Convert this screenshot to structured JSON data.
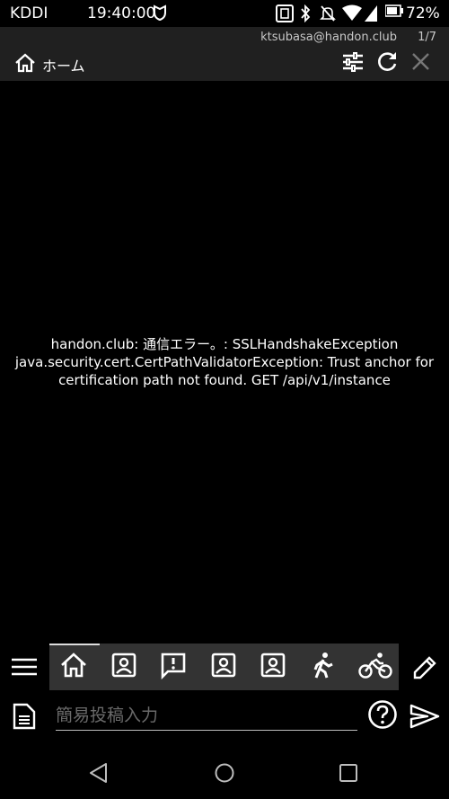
{
  "status_bar": {
    "carrier": "KDDI",
    "time": "19:40:00",
    "battery_percent": "72%",
    "icons": [
      "shield-icon",
      "nfc-icon",
      "bluetooth-icon",
      "mute-icon",
      "wifi-icon",
      "battery-icon"
    ]
  },
  "header": {
    "account": "ktsubasa@handon.club",
    "page_indicator": "1/7",
    "column_title": "ホーム"
  },
  "main": {
    "error_lines": [
      "handon.club: 通信エラー。: SSLHandshakeException",
      "java.security.cert.CertPathValidatorException: Trust anchor for",
      "certification path not found. GET /api/v1/instance"
    ]
  },
  "tabs": [
    {
      "icon": "home-icon",
      "selected": true
    },
    {
      "icon": "contact-icon"
    },
    {
      "icon": "notification-icon"
    },
    {
      "icon": "contact-icon"
    },
    {
      "icon": "contact-icon"
    },
    {
      "icon": "walk-icon"
    },
    {
      "icon": "bike-icon"
    }
  ],
  "post": {
    "placeholder": "簡易投稿入力"
  },
  "colors": {
    "background": "#000000",
    "header": "#202020",
    "tabstrip": "#333333"
  }
}
